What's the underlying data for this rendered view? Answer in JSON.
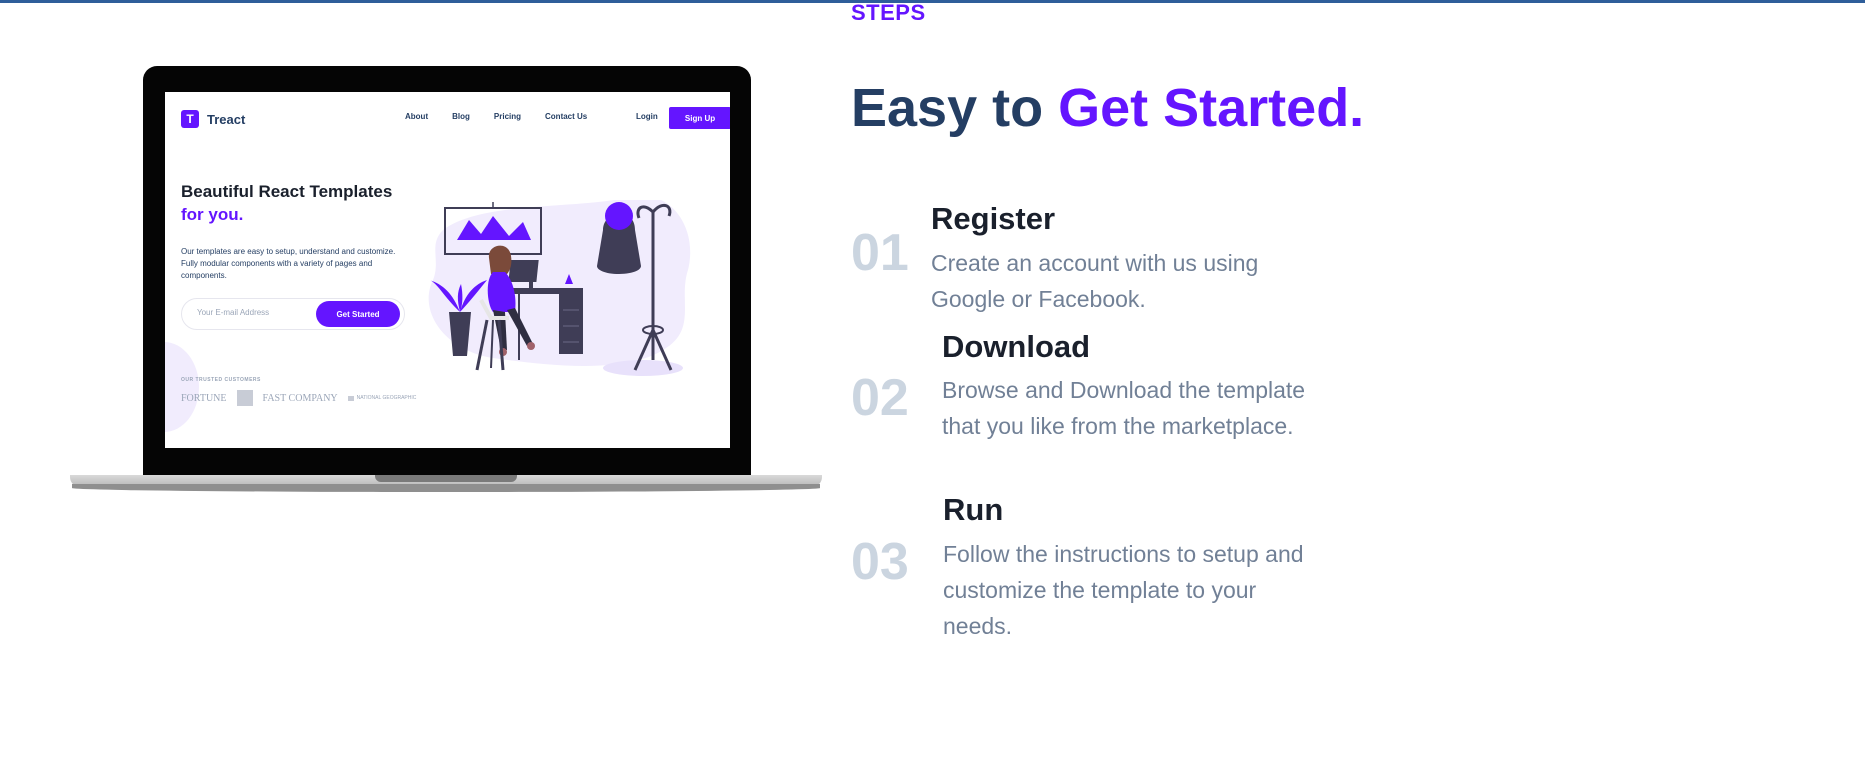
{
  "section": {
    "label": "STEPS",
    "heading_main": "Easy to",
    "heading_accent": "Get Started."
  },
  "steps": [
    {
      "number": "01",
      "title": "Register",
      "description": "Create an account with us using Google or Facebook."
    },
    {
      "number": "02",
      "title": "Download",
      "description": "Browse and Download the template that you like from the marketplace."
    },
    {
      "number": "03",
      "title": "Run",
      "description": "Follow the instructions to setup and customize the template to your needs."
    }
  ],
  "mockup": {
    "logo_letter": "T",
    "brand": "Treact",
    "nav_links": [
      "About",
      "Blog",
      "Pricing",
      "Contact Us"
    ],
    "login": "Login",
    "signup": "Sign Up",
    "hero_title_main": "Beautiful React Templates",
    "hero_title_accent": "for you.",
    "hero_description": "Our templates are easy to setup, understand and customize. Fully modular components with a variety of pages and components.",
    "email_placeholder": "Your E-mail Address",
    "cta": "Get Started",
    "trusted_label": "OUR TRUSTED CUSTOMERS",
    "customer_logos": [
      "FORTUNE",
      "FAST COMPANY",
      "NATIONAL GEOGRAPHIC"
    ]
  },
  "colors": {
    "accent": "#6415ff",
    "heading": "#243e63",
    "muted_number": "#cbd5e0",
    "body_text": "#718096"
  }
}
